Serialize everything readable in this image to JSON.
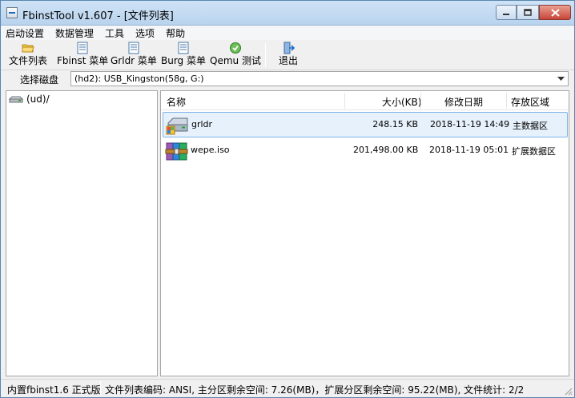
{
  "window": {
    "title": "FbinstTool v1.607 - [文件列表]"
  },
  "menu": [
    "启动设置",
    "数据管理",
    "工具",
    "选项",
    "帮助"
  ],
  "toolbar": {
    "file_list": "文件列表",
    "fbinst_menu": "Fbinst 菜单",
    "grldr_menu": "Grldr 菜单",
    "burg_menu": "Burg 菜单",
    "qemu_test": "Qemu 测试",
    "exit": "退出"
  },
  "disk": {
    "label": "选择磁盘",
    "selected": "(hd2): USB_Kingston(58g, G:)"
  },
  "tree": {
    "root": "(ud)/"
  },
  "columns": {
    "name": "名称",
    "size": "大小(KB)",
    "modified": "修改日期",
    "area": "存放区域"
  },
  "files": [
    {
      "name": "grldr",
      "size": "248.15 KB",
      "modified": "2018-11-19 14:49",
      "area": "主数据区",
      "icon": "drive-icon",
      "selected": true
    },
    {
      "name": "wepe.iso",
      "size": "201,498.00 KB",
      "modified": "2018-11-19 05:01",
      "area": "扩展数据区",
      "icon": "archive-icon",
      "selected": false
    }
  ],
  "status": {
    "version": "内置fbinst1.6 正式版",
    "info": "文件列表编码: ANSI, 主分区剩余空间: 7.26(MB)，扩展分区剩余空间: 95.22(MB), 文件统计: 2/2"
  },
  "colors": {
    "accent": "#1a6cc8",
    "selection": "#e6f1fb",
    "selection_border": "#7eb4ea",
    "close_button": "#c9453a"
  }
}
